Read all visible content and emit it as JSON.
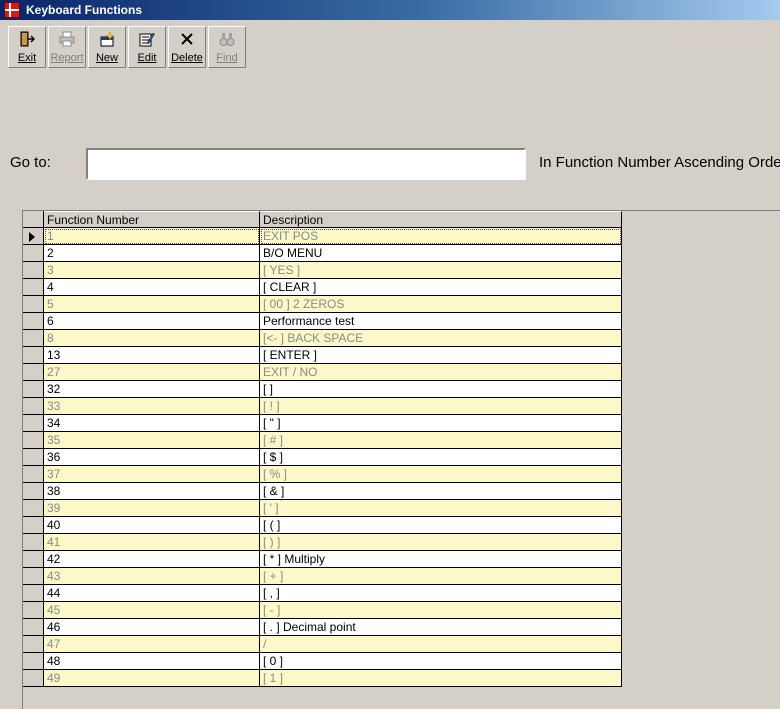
{
  "window": {
    "title": "Keyboard Functions"
  },
  "toolbar": {
    "buttons": [
      {
        "label": "Exit",
        "enabled": true,
        "icon": "exit-door-icon"
      },
      {
        "label": "Report",
        "enabled": false,
        "icon": "printer-icon"
      },
      {
        "label": "New",
        "enabled": true,
        "icon": "new-record-icon"
      },
      {
        "label": "Edit",
        "enabled": true,
        "icon": "edit-record-icon"
      },
      {
        "label": "Delete",
        "enabled": true,
        "icon": "delete-x-icon"
      },
      {
        "label": "Find",
        "enabled": false,
        "icon": "binoculars-icon"
      }
    ]
  },
  "goto": {
    "label": "Go to:",
    "value": "",
    "order_text": "In Function Number Ascending Order"
  },
  "grid": {
    "columns": [
      "Function Number",
      "Description"
    ],
    "selected_row": 0,
    "rows": [
      {
        "number": "1",
        "description": "EXIT POS"
      },
      {
        "number": "2",
        "description": "B/O MENU"
      },
      {
        "number": "3",
        "description": "[ YES ]"
      },
      {
        "number": "4",
        "description": "[ CLEAR ]"
      },
      {
        "number": "5",
        "description": "[ 00 ] 2 ZEROS"
      },
      {
        "number": "6",
        "description": "Performance test"
      },
      {
        "number": "8",
        "description": "[<- ] BACK SPACE"
      },
      {
        "number": "13",
        "description": "[ ENTER ]"
      },
      {
        "number": "27",
        "description": "EXIT / NO"
      },
      {
        "number": "32",
        "description": "[ ]"
      },
      {
        "number": "33",
        "description": "[ ! ]"
      },
      {
        "number": "34",
        "description": "[ \" ]"
      },
      {
        "number": "35",
        "description": "[ # ]"
      },
      {
        "number": "36",
        "description": "[ $ ]"
      },
      {
        "number": "37",
        "description": "[ % ]"
      },
      {
        "number": "38",
        "description": "[ & ]"
      },
      {
        "number": "39",
        "description": "[ ' ]"
      },
      {
        "number": "40",
        "description": "[ ( ]"
      },
      {
        "number": "41",
        "description": "[ ) ]"
      },
      {
        "number": "42",
        "description": "[ * ] Multiply"
      },
      {
        "number": "43",
        "description": "[ + ]"
      },
      {
        "number": "44",
        "description": "[ , ]"
      },
      {
        "number": "45",
        "description": "[ - ]"
      },
      {
        "number": "46",
        "description": "[ . ] Decimal point"
      },
      {
        "number": "47",
        "description": "/"
      },
      {
        "number": "48",
        "description": "[ 0 ]"
      },
      {
        "number": "49",
        "description": "[ 1 ]"
      }
    ]
  }
}
